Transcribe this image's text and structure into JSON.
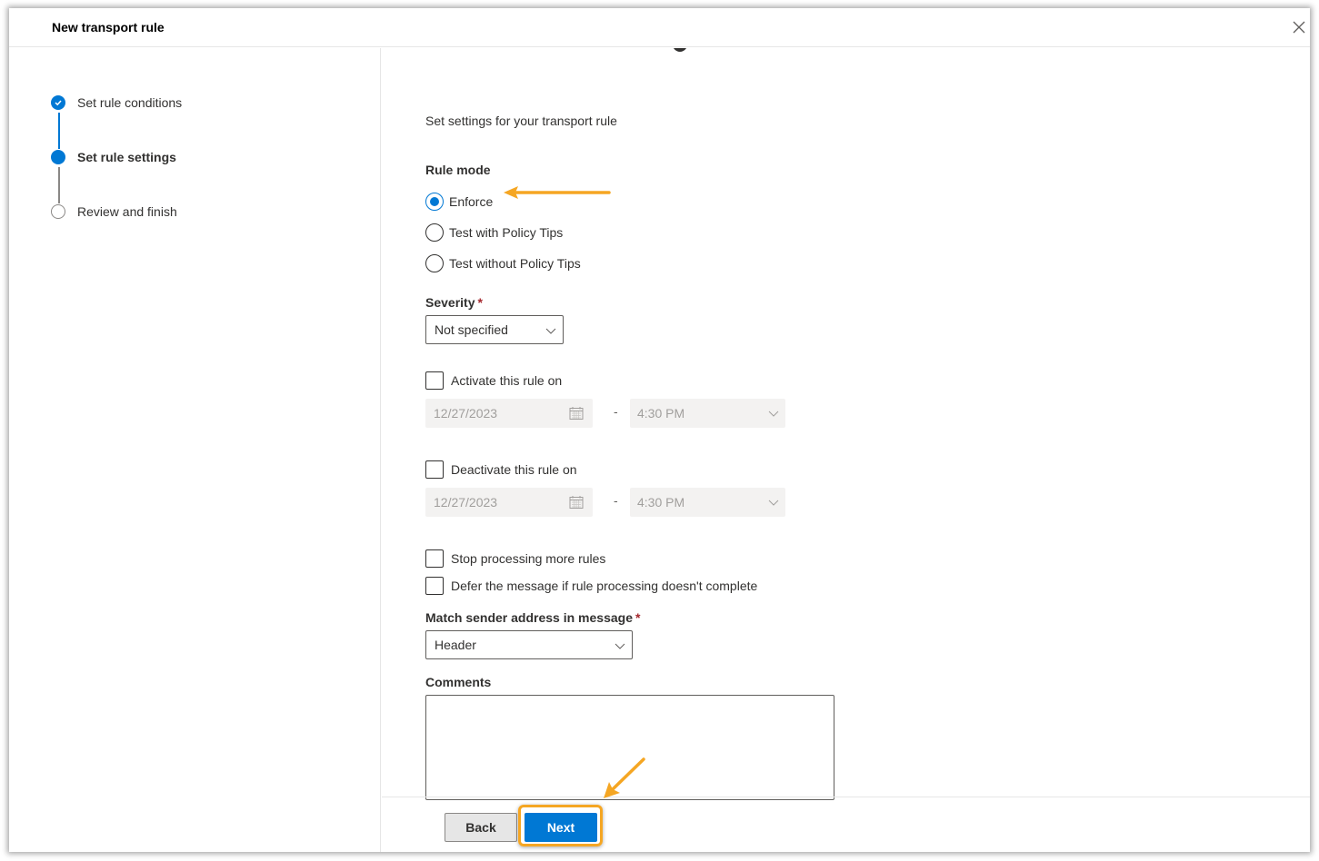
{
  "header": {
    "title": "New transport rule",
    "close_icon": "close-icon"
  },
  "steps": [
    {
      "label": "Set rule conditions",
      "state": "completed"
    },
    {
      "label": "Set rule settings",
      "state": "current"
    },
    {
      "label": "Review and finish",
      "state": "pending"
    }
  ],
  "content": {
    "subtitle": "Set settings for your transport rule",
    "rule_mode": {
      "label": "Rule mode",
      "options": [
        {
          "label": "Enforce",
          "selected": true
        },
        {
          "label": "Test with Policy Tips",
          "selected": false
        },
        {
          "label": "Test without Policy Tips",
          "selected": false
        }
      ]
    },
    "severity": {
      "label": "Severity",
      "required_mark": "*",
      "value": "Not specified"
    },
    "activate": {
      "label": "Activate this rule on",
      "checked": false,
      "date": "12/27/2023",
      "separator": "-",
      "time": "4:30 PM"
    },
    "deactivate": {
      "label": "Deactivate this rule on",
      "checked": false,
      "date": "12/27/2023",
      "separator": "-",
      "time": "4:30 PM"
    },
    "stop_processing": {
      "label": "Stop processing more rules",
      "checked": false
    },
    "defer_message": {
      "label": "Defer the message if rule processing doesn't complete",
      "checked": false
    },
    "match_sender": {
      "label": "Match sender address in message",
      "required_mark": "*",
      "value": "Header"
    },
    "comments": {
      "label": "Comments",
      "value": ""
    }
  },
  "footer": {
    "back_label": "Back",
    "next_label": "Next"
  },
  "colors": {
    "accent": "#0078d4",
    "annotation": "#f5a623",
    "required": "#a4262c"
  }
}
